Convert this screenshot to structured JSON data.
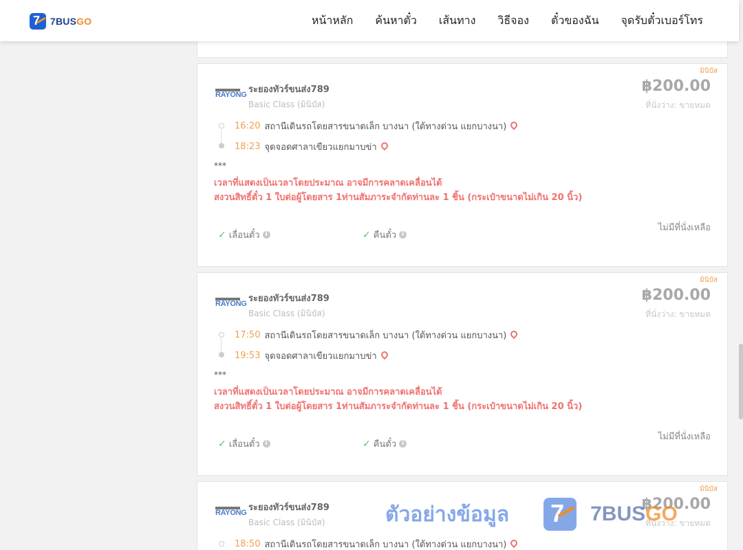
{
  "header": {
    "logo": {
      "text_main": "7BUS",
      "text_accent": "GO",
      "mark": "7"
    },
    "nav": [
      "หน้าหลัก",
      "ค้นหาตั๋ว",
      "เส้นทาง",
      "วิธีจอง",
      "ตั๋วของฉัน",
      "จุดรับตั๋วเบอร์โทร"
    ]
  },
  "trips": [
    {
      "badge": "มินิบัส",
      "operator_logo": "RAYONG",
      "operator": "ระยองทัวร์ขนส่ง789",
      "bus_class": "Basic Class (มินิบัส)",
      "price": "฿200.00",
      "seats": "ที่นั่งว่าง: ขายหมด",
      "depart_time": "16:20",
      "depart_place": "สถานีเดินรถโดยสารขนาดเล็ก บางนา (ใต้ทางด่วน แยกบางนา)",
      "arrive_time": "18:23",
      "arrive_place": "จุดจอดศาลาเขียวแยกมาบข่า",
      "stars": "***",
      "notice_1": "เวลาที่แสดงเป็นเวลาโดยประมาณ อาจมีการคลาดเคลื่อนได้",
      "notice_2": "สงวนสิทธิ์ตั๋ว 1 ใบต่อผู้โดยสาร 1ท่านสัมภาระจำกัดท่านละ 1 ชิ้น (กระเป๋าขนาดไม่เกิน 20 นิ้ว)",
      "feature_1": "เลื่อนตั๋ว",
      "feature_2": "คืนตั๋ว",
      "status": "ไม่มีที่นั่งเหลือ"
    },
    {
      "badge": "มินิบัส",
      "operator_logo": "RAYONG",
      "operator": "ระยองทัวร์ขนส่ง789",
      "bus_class": "Basic Class (มินิบัส)",
      "price": "฿200.00",
      "seats": "ที่นั่งว่าง: ขายหมด",
      "depart_time": "17:50",
      "depart_place": "สถานีเดินรถโดยสารขนาดเล็ก บางนา (ใต้ทางด่วน แยกบางนา)",
      "arrive_time": "19:53",
      "arrive_place": "จุดจอดศาลาเขียวแยกมาบข่า",
      "stars": "***",
      "notice_1": "เวลาที่แสดงเป็นเวลาโดยประมาณ อาจมีการคลาดเคลื่อนได้",
      "notice_2": "สงวนสิทธิ์ตั๋ว 1 ใบต่อผู้โดยสาร 1ท่านสัมภาระจำกัดท่านละ 1 ชิ้น (กระเป๋าขนาดไม่เกิน 20 นิ้ว)",
      "feature_1": "เลื่อนตั๋ว",
      "feature_2": "คืนตั๋ว",
      "status": "ไม่มีที่นั่งเหลือ"
    },
    {
      "badge": "มินิบัส",
      "operator_logo": "RAYONG",
      "operator": "ระยองทัวร์ขนส่ง789",
      "bus_class": "Basic Class (มินิบัส)",
      "price": "฿200.00",
      "seats": "ที่นั่งว่าง: ขายหมด",
      "depart_time": "18:50",
      "depart_place": "สถานีเดินรถโดยสารขนาดเล็ก บางนา (ใต้ทางด่วน แยกบางนา)"
    }
  ],
  "watermark": {
    "text": "ตัวอย่างข้อมูล",
    "brand_main": "7BUS",
    "brand_accent": "GO",
    "mark": "7"
  },
  "colors": {
    "brand_blue": "#1f5fd6",
    "brand_orange": "#f28c28",
    "notice_red": "#f07070",
    "time_orange": "#f0a050",
    "check_green": "#5cbf6b"
  }
}
